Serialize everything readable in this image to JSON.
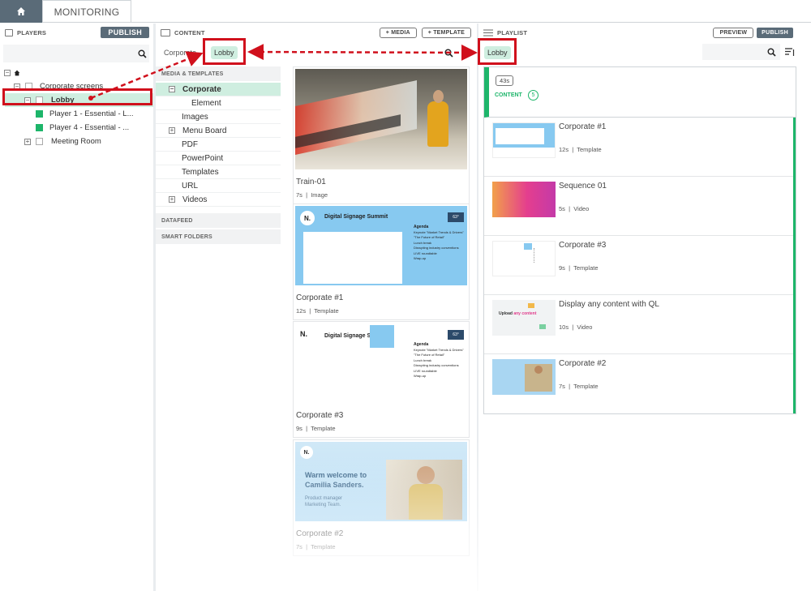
{
  "nav": {
    "monitoring_label": "MONITORING"
  },
  "players": {
    "header": "PLAYERS",
    "publish_label": "PUBLISH",
    "tree": {
      "root": "Corporate screens",
      "lobby": "Lobby",
      "player1": "Player 1 - Essential - L...",
      "player4": "Player 4 - Essential - ...",
      "meeting_room": "Meeting Room"
    }
  },
  "content": {
    "header": "CONTENT",
    "add_media_label": "+ MEDIA",
    "add_template_label": "+ TEMPLATE",
    "breadcrumb": "Corporate",
    "lobby_chip": "Lobby",
    "sections": {
      "media_templates": "MEDIA & TEMPLATES",
      "datafeed": "DATAFEED",
      "smart_folders": "SMART FOLDERS"
    },
    "tree": {
      "corporate": "Corporate",
      "element": "Element",
      "images": "Images",
      "menu_board": "Menu Board",
      "pdf": "PDF",
      "powerpoint": "PowerPoint",
      "templates": "Templates",
      "url": "URL",
      "videos": "Videos"
    },
    "cards": [
      {
        "title": "Train-01",
        "duration": "7s",
        "type": "Image"
      },
      {
        "title": "Corporate #1",
        "duration": "12s",
        "type": "Template"
      },
      {
        "title": "Corporate #3",
        "duration": "9s",
        "type": "Template"
      },
      {
        "title": "Corporate #2",
        "duration": "7s",
        "type": "Template"
      }
    ],
    "thumb_text": {
      "summit": "Digital Signage Summit",
      "agenda": "Agenda",
      "time": "10:41 AM",
      "date": "October 4",
      "temp": "63°",
      "logo": "N.",
      "a1t": "10:00",
      "a1": "Keynote \"Market Trends & Drivers\"",
      "a2t": "11:00",
      "a2": "\"The Future of Retail\"",
      "a3t": "12:00",
      "a3": "Lunch break",
      "a4t": "14:00",
      "a4": "Disrupting industry conventions",
      "a5t": "15:00",
      "a5": "LIVE roundtable",
      "a6t": "17:00",
      "a6": "Wrap-up",
      "welcome1": "Warm welcome to",
      "welcome2": "Camilia Sanders.",
      "role1": "Product manager",
      "role2": "Marketing Team."
    }
  },
  "playlist": {
    "header": "PLAYLIST",
    "preview_label": "PREVIEW",
    "publish_label": "PUBLISH",
    "lobby_chip": "Lobby",
    "total_duration": "43s",
    "content_label": "CONTENT",
    "content_count": "5",
    "items": [
      {
        "title": "Corporate #1",
        "duration": "12s",
        "type": "Template"
      },
      {
        "title": "Sequence 01",
        "duration": "5s",
        "type": "Video"
      },
      {
        "title": "Corporate #3",
        "duration": "9s",
        "type": "Template"
      },
      {
        "title": "Display any content with QL",
        "duration": "10s",
        "type": "Video"
      },
      {
        "title": "Corporate #2",
        "duration": "7s",
        "type": "Template"
      }
    ],
    "upload_text_1": "Upload",
    "upload_text_2": "any content"
  },
  "colors": {
    "accent_green": "#1db56a",
    "chip_bg": "#cfeee0",
    "annotation_red": "#d0101c",
    "dark_button": "#5a6b78"
  }
}
